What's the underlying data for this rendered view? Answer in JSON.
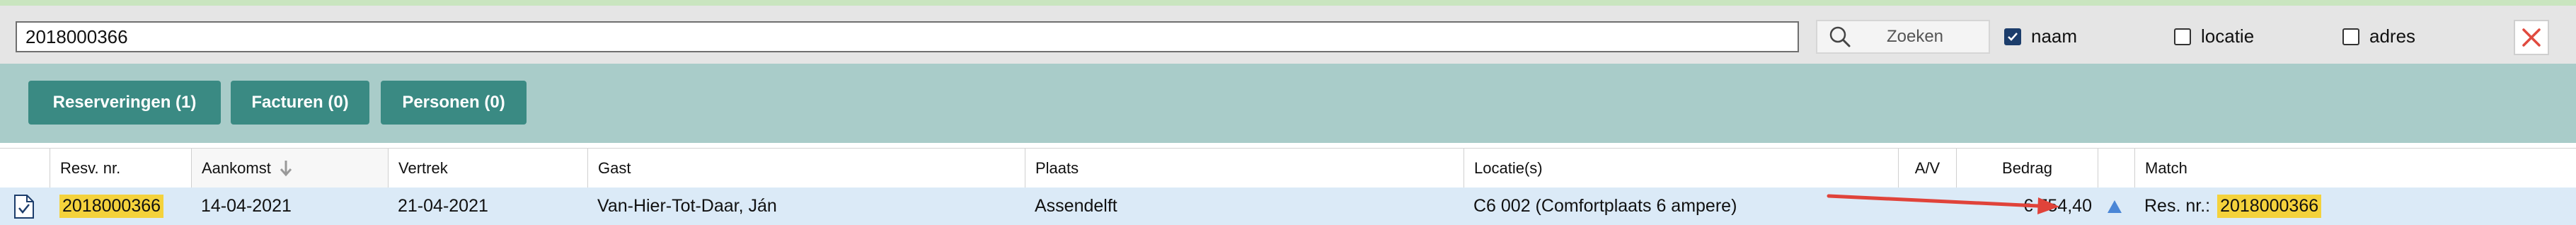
{
  "search": {
    "query": "2018000366",
    "button_label": "Zoeken",
    "filters": [
      {
        "label": "naam",
        "checked": true
      },
      {
        "label": "locatie",
        "checked": false
      },
      {
        "label": "adres",
        "checked": false
      }
    ]
  },
  "tabs": [
    {
      "label": "Reserveringen (1)"
    },
    {
      "label": "Facturen (0)"
    },
    {
      "label": "Personen (0)"
    }
  ],
  "table": {
    "columns": {
      "resv_nr": "Resv. nr.",
      "aankomst": "Aankomst",
      "vertrek": "Vertrek",
      "gast": "Gast",
      "plaats": "Plaats",
      "locatie": "Locatie(s)",
      "av": "A/V",
      "bedrag": "Bedrag",
      "match": "Match"
    },
    "rows": [
      {
        "resv_nr": "2018000366",
        "aankomst": "14-04-2021",
        "vertrek": "21-04-2021",
        "gast": "Van-Hier-Tot-Daar, Ján",
        "plaats": "Assendelft",
        "locatie": "C6 002 (Comfortplaats 6 ampere)",
        "av": "",
        "bedrag": "€ 754,40",
        "match_prefix": "Res. nr.:",
        "match_value": "2018000366"
      }
    ]
  },
  "colors": {
    "accent_tab": "#3a8a83",
    "tab_band": "#a9ccc9",
    "highlight": "#f4d23c",
    "row_bg": "#dbeaf7",
    "annotation_arrow": "#e0433a"
  }
}
